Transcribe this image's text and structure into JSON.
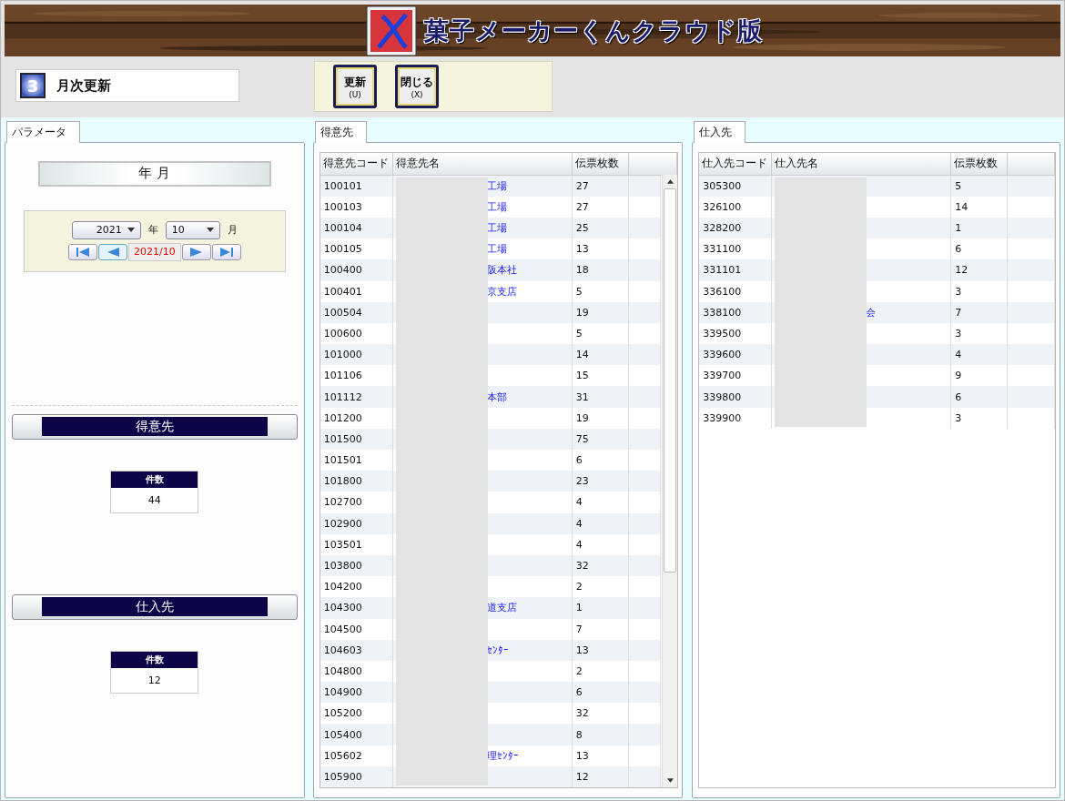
{
  "app": {
    "title": "菓子メーカーくんクラウド版"
  },
  "screen": {
    "badge": "3",
    "title": "月次更新"
  },
  "toolbar": [
    {
      "label": "更新",
      "key": "(U)"
    },
    {
      "label": "閉じる",
      "key": "(X)"
    }
  ],
  "parameter_panel": {
    "tab": "パラメータ",
    "heading": "年 月",
    "year": "2021",
    "year_unit": "年",
    "month": "10",
    "month_unit": "月",
    "period": "2021/10",
    "sections": [
      {
        "title": "得意先",
        "count_label": "件数",
        "count": "44"
      },
      {
        "title": "仕入先",
        "count_label": "件数",
        "count": "12"
      }
    ]
  },
  "customers": {
    "tab": "得意先",
    "columns": [
      "得意先コード",
      "得意先名",
      "伝票枚数"
    ],
    "rows": [
      {
        "code": "100101",
        "name": "工場",
        "slips": "27"
      },
      {
        "code": "100103",
        "name": "工場",
        "slips": "27"
      },
      {
        "code": "100104",
        "name": "工場",
        "slips": "25"
      },
      {
        "code": "100105",
        "name": "工場",
        "slips": "13"
      },
      {
        "code": "100400",
        "name": "阪本社",
        "slips": "18"
      },
      {
        "code": "100401",
        "name": "京支店",
        "slips": "5"
      },
      {
        "code": "100504",
        "name": "",
        "slips": "19"
      },
      {
        "code": "100600",
        "name": "",
        "slips": "5"
      },
      {
        "code": "101000",
        "name": "",
        "slips": "14"
      },
      {
        "code": "101106",
        "name": "",
        "slips": "15"
      },
      {
        "code": "101112",
        "name": "本部",
        "slips": "31"
      },
      {
        "code": "101200",
        "name": "",
        "slips": "19"
      },
      {
        "code": "101500",
        "name": "",
        "slips": "75"
      },
      {
        "code": "101501",
        "name": "",
        "slips": "6"
      },
      {
        "code": "101800",
        "name": "",
        "slips": "23"
      },
      {
        "code": "102700",
        "name": "",
        "slips": "4"
      },
      {
        "code": "102900",
        "name": "",
        "slips": "4"
      },
      {
        "code": "103501",
        "name": "",
        "slips": "4"
      },
      {
        "code": "103800",
        "name": "",
        "slips": "32"
      },
      {
        "code": "104200",
        "name": "",
        "slips": "2"
      },
      {
        "code": "104300",
        "name": "道支店",
        "slips": "1"
      },
      {
        "code": "104500",
        "name": "",
        "slips": "7"
      },
      {
        "code": "104603",
        "name": "ｾﾝﾀｰ",
        "slips": "13"
      },
      {
        "code": "104800",
        "name": "",
        "slips": "2"
      },
      {
        "code": "104900",
        "name": "",
        "slips": "6"
      },
      {
        "code": "105200",
        "name": "",
        "slips": "32"
      },
      {
        "code": "105400",
        "name": "",
        "slips": "8"
      },
      {
        "code": "105602",
        "name": "理ｾﾝﾀｰ",
        "slips": "13"
      },
      {
        "code": "105900",
        "name": "",
        "slips": "12"
      }
    ]
  },
  "suppliers": {
    "tab": "仕入先",
    "columns": [
      "仕入先コード",
      "仕入先名",
      "伝票枚数"
    ],
    "rows": [
      {
        "code": "305300",
        "name": "",
        "slips": "5"
      },
      {
        "code": "326100",
        "name": "",
        "slips": "14"
      },
      {
        "code": "328200",
        "name": "",
        "slips": "1"
      },
      {
        "code": "331100",
        "name": "",
        "slips": "6"
      },
      {
        "code": "331101",
        "name": "",
        "slips": "12"
      },
      {
        "code": "336100",
        "name": "",
        "slips": "3"
      },
      {
        "code": "338100",
        "name": "会",
        "slips": "7"
      },
      {
        "code": "339500",
        "name": "",
        "slips": "3"
      },
      {
        "code": "339600",
        "name": "",
        "slips": "4"
      },
      {
        "code": "339700",
        "name": "",
        "slips": "9"
      },
      {
        "code": "339800",
        "name": "",
        "slips": "6"
      },
      {
        "code": "339900",
        "name": "",
        "slips": "3"
      }
    ]
  }
}
